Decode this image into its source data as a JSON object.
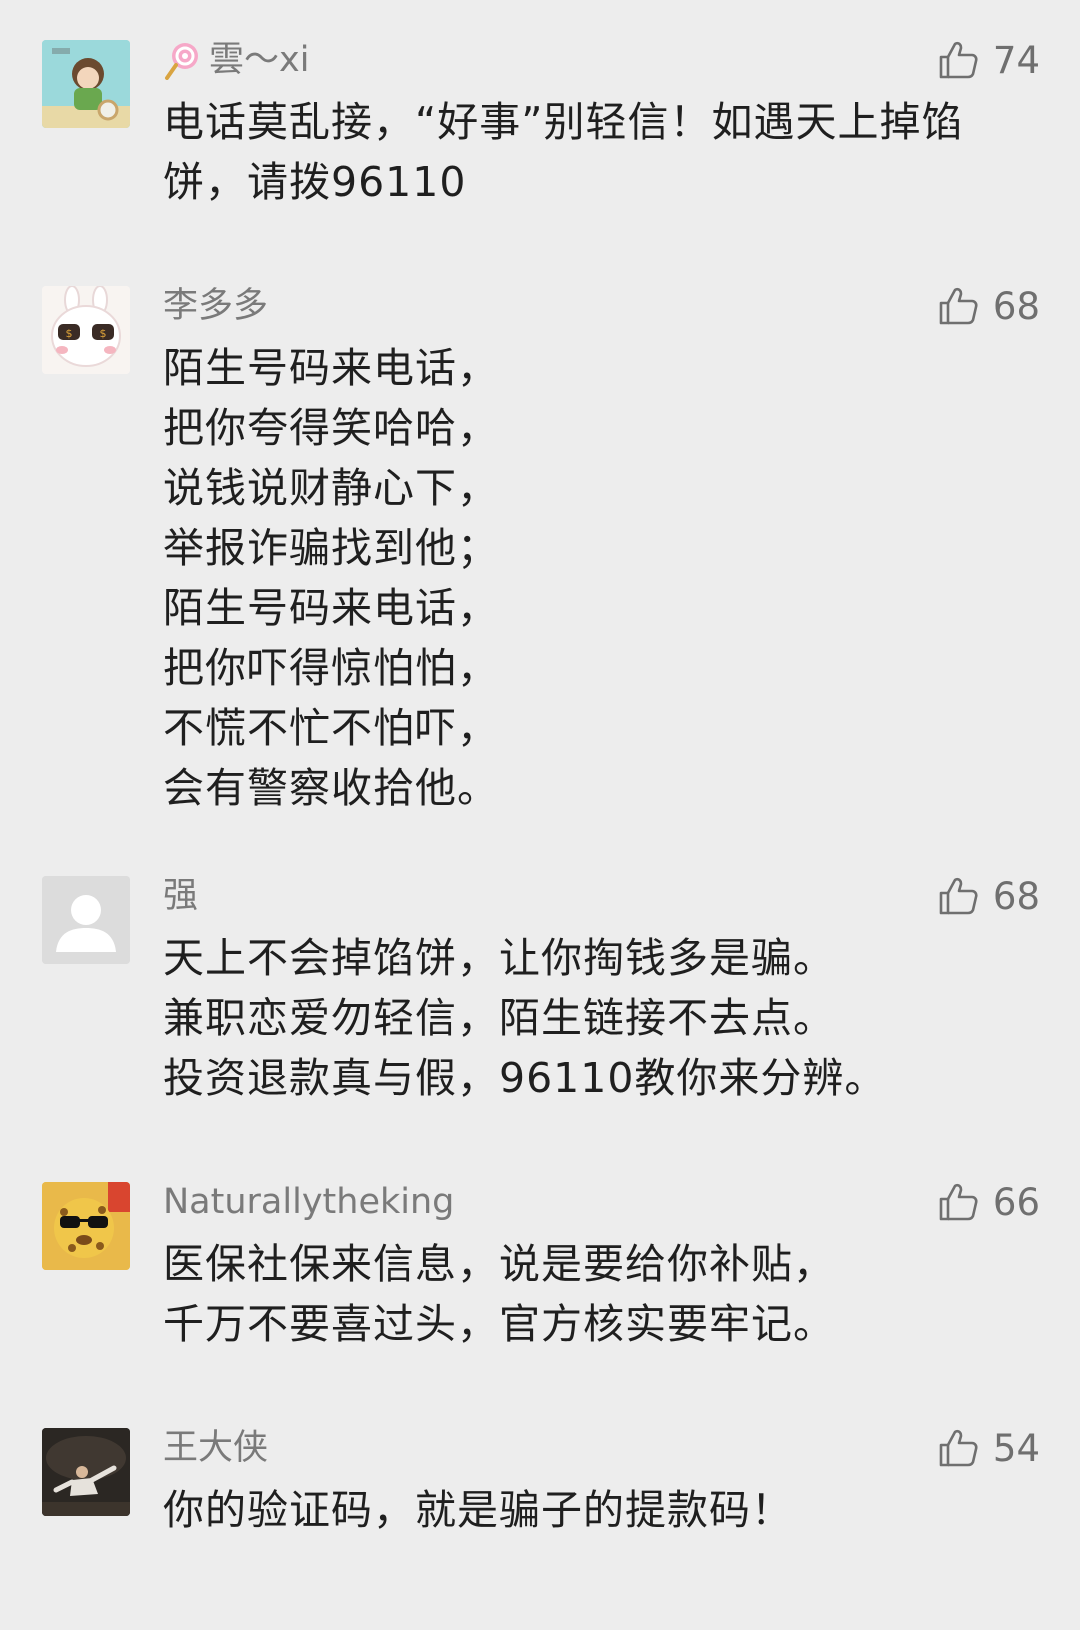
{
  "comments": [
    {
      "user": "雲～xi",
      "likes": "74",
      "text": "电话莫乱接，“好事”别轻信！如遇天上掉馅\n饼，请拨96110",
      "avatar_icon": "girl-cartoon-avatar",
      "name_icon": "lollipop-icon"
    },
    {
      "user": "李多多",
      "likes": "68",
      "text": "陌生号码来电话，\n把你夸得笑哈哈，\n说钱说财静心下，\n举报诈骗找到他；\n陌生号码来电话，\n把你吓得惊怕怕，\n不慌不忙不怕吓，\n会有警察收拾他。",
      "avatar_icon": "bunny-sunglasses-avatar"
    },
    {
      "user": "强",
      "likes": "68",
      "text": "天上不会掉馅饼，让你掏钱多是骗。\n兼职恋爱勿轻信，陌生链接不去点。\n投资退款真与假，96110教你来分辨。",
      "avatar_icon": "default-person-avatar"
    },
    {
      "user": "Naturallytheking",
      "likes": "66",
      "text": "医保社保来信息，说是要给你补贴，\n千万不要喜过头，官方核实要牢记。",
      "avatar_icon": "leopard-sunglasses-avatar"
    },
    {
      "user": "王大侠",
      "likes": "54",
      "text": "你的验证码，就是骗子的提款码！",
      "avatar_icon": "martial-artist-avatar"
    }
  ],
  "colors": {
    "background": "#ededed",
    "username": "#7a7a7a",
    "body_text": "#1f1f1f",
    "like": "#6f6f6f"
  }
}
